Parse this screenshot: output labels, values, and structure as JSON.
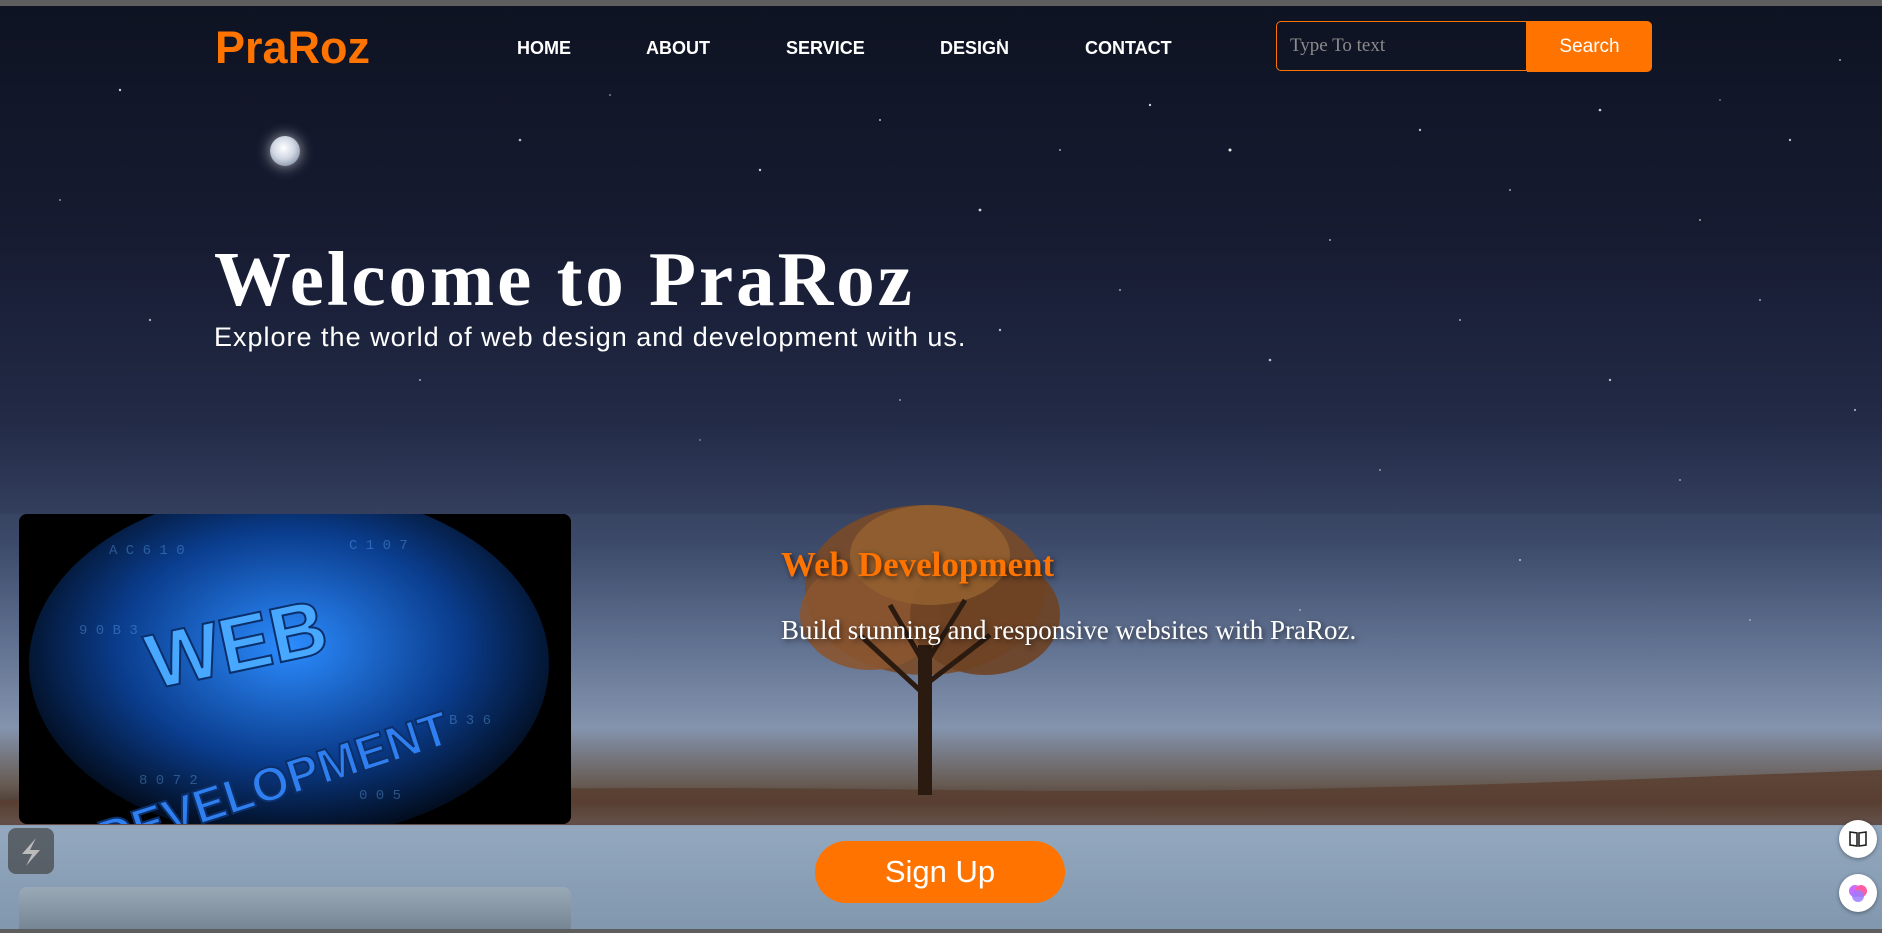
{
  "brand": {
    "logo_text": "PraRoz",
    "accent_color": "#ff7300"
  },
  "nav": {
    "items": [
      {
        "label": "HOME"
      },
      {
        "label": "ABOUT"
      },
      {
        "label": "SERVICE"
      },
      {
        "label": "DESIGN"
      },
      {
        "label": "CONTACT"
      }
    ]
  },
  "search": {
    "placeholder": "Type To text",
    "button_label": "Search"
  },
  "hero": {
    "title": "Welcome to PraRoz",
    "subtitle": "Explore the world of web design and development with us."
  },
  "services": [
    {
      "image_text_line1": "WEB",
      "image_text_line2": "DEVELOPMENT",
      "title": "Web Development",
      "description": "Build stunning and responsive websites with PraRoz."
    }
  ],
  "cta": {
    "signup_label": "Sign Up"
  },
  "icons": {
    "moon": "moon-icon",
    "side_widget": "lightning-icon",
    "reader": "book-icon",
    "ai": "brain-icon"
  }
}
